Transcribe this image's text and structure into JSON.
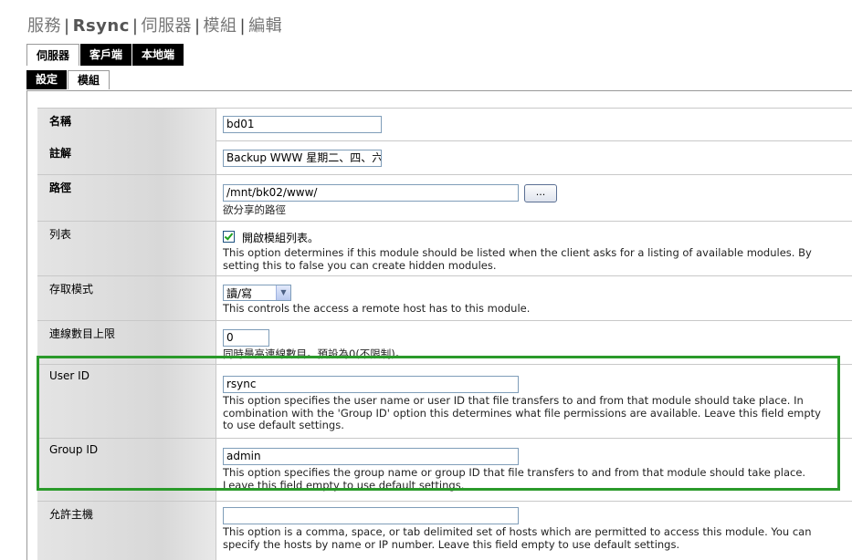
{
  "breadcrumb": [
    "服務",
    "Rsync",
    "伺服器",
    "模組",
    "編輯"
  ],
  "tabs": [
    "伺服器",
    "客戶端",
    "本地端"
  ],
  "subtabs": [
    "設定",
    "模組"
  ],
  "fields": {
    "name": {
      "label": "名稱",
      "value": "bd01"
    },
    "comment": {
      "label": "註解",
      "value": "Backup WWW 星期二、四、六"
    },
    "path": {
      "label": "路徑",
      "value": "/mnt/bk02/www/",
      "button": "...",
      "desc": "欲分享的路徑"
    },
    "list": {
      "label": "列表",
      "checked": true,
      "checkbox_label": "開啟模組列表。",
      "desc": "This option determines if this module should be listed when the client asks for a listing of available modules. By setting this to false you can create hidden modules."
    },
    "access": {
      "label": "存取模式",
      "value": "讀/寫",
      "desc": "This controls the access a remote host has to this module."
    },
    "maxconn": {
      "label": "連線數目上限",
      "value": "0",
      "desc": "同時最高連線數目。預設為0(不限制)。"
    },
    "uid": {
      "label": "User ID",
      "value": "rsync",
      "desc": "This option specifies the user name or user ID that file transfers to and from that module should take place. In combination with the 'Group ID' option this determines what file permissions are available. Leave this field empty to use default settings."
    },
    "gid": {
      "label": "Group ID",
      "value": "admin",
      "desc": "This option specifies the group name or group ID that file transfers to and from that module should take place. Leave this field empty to use default settings."
    },
    "hosts": {
      "label": "允許主機",
      "value": "",
      "desc": "This option is a comma, space, or tab delimited set of hosts which are permitted to access this module. You can specify the hosts by name or IP number. Leave this field empty to use default settings."
    }
  },
  "colors": {
    "highlight": "#2a9a2a",
    "tab_active_bg": "#000000"
  }
}
